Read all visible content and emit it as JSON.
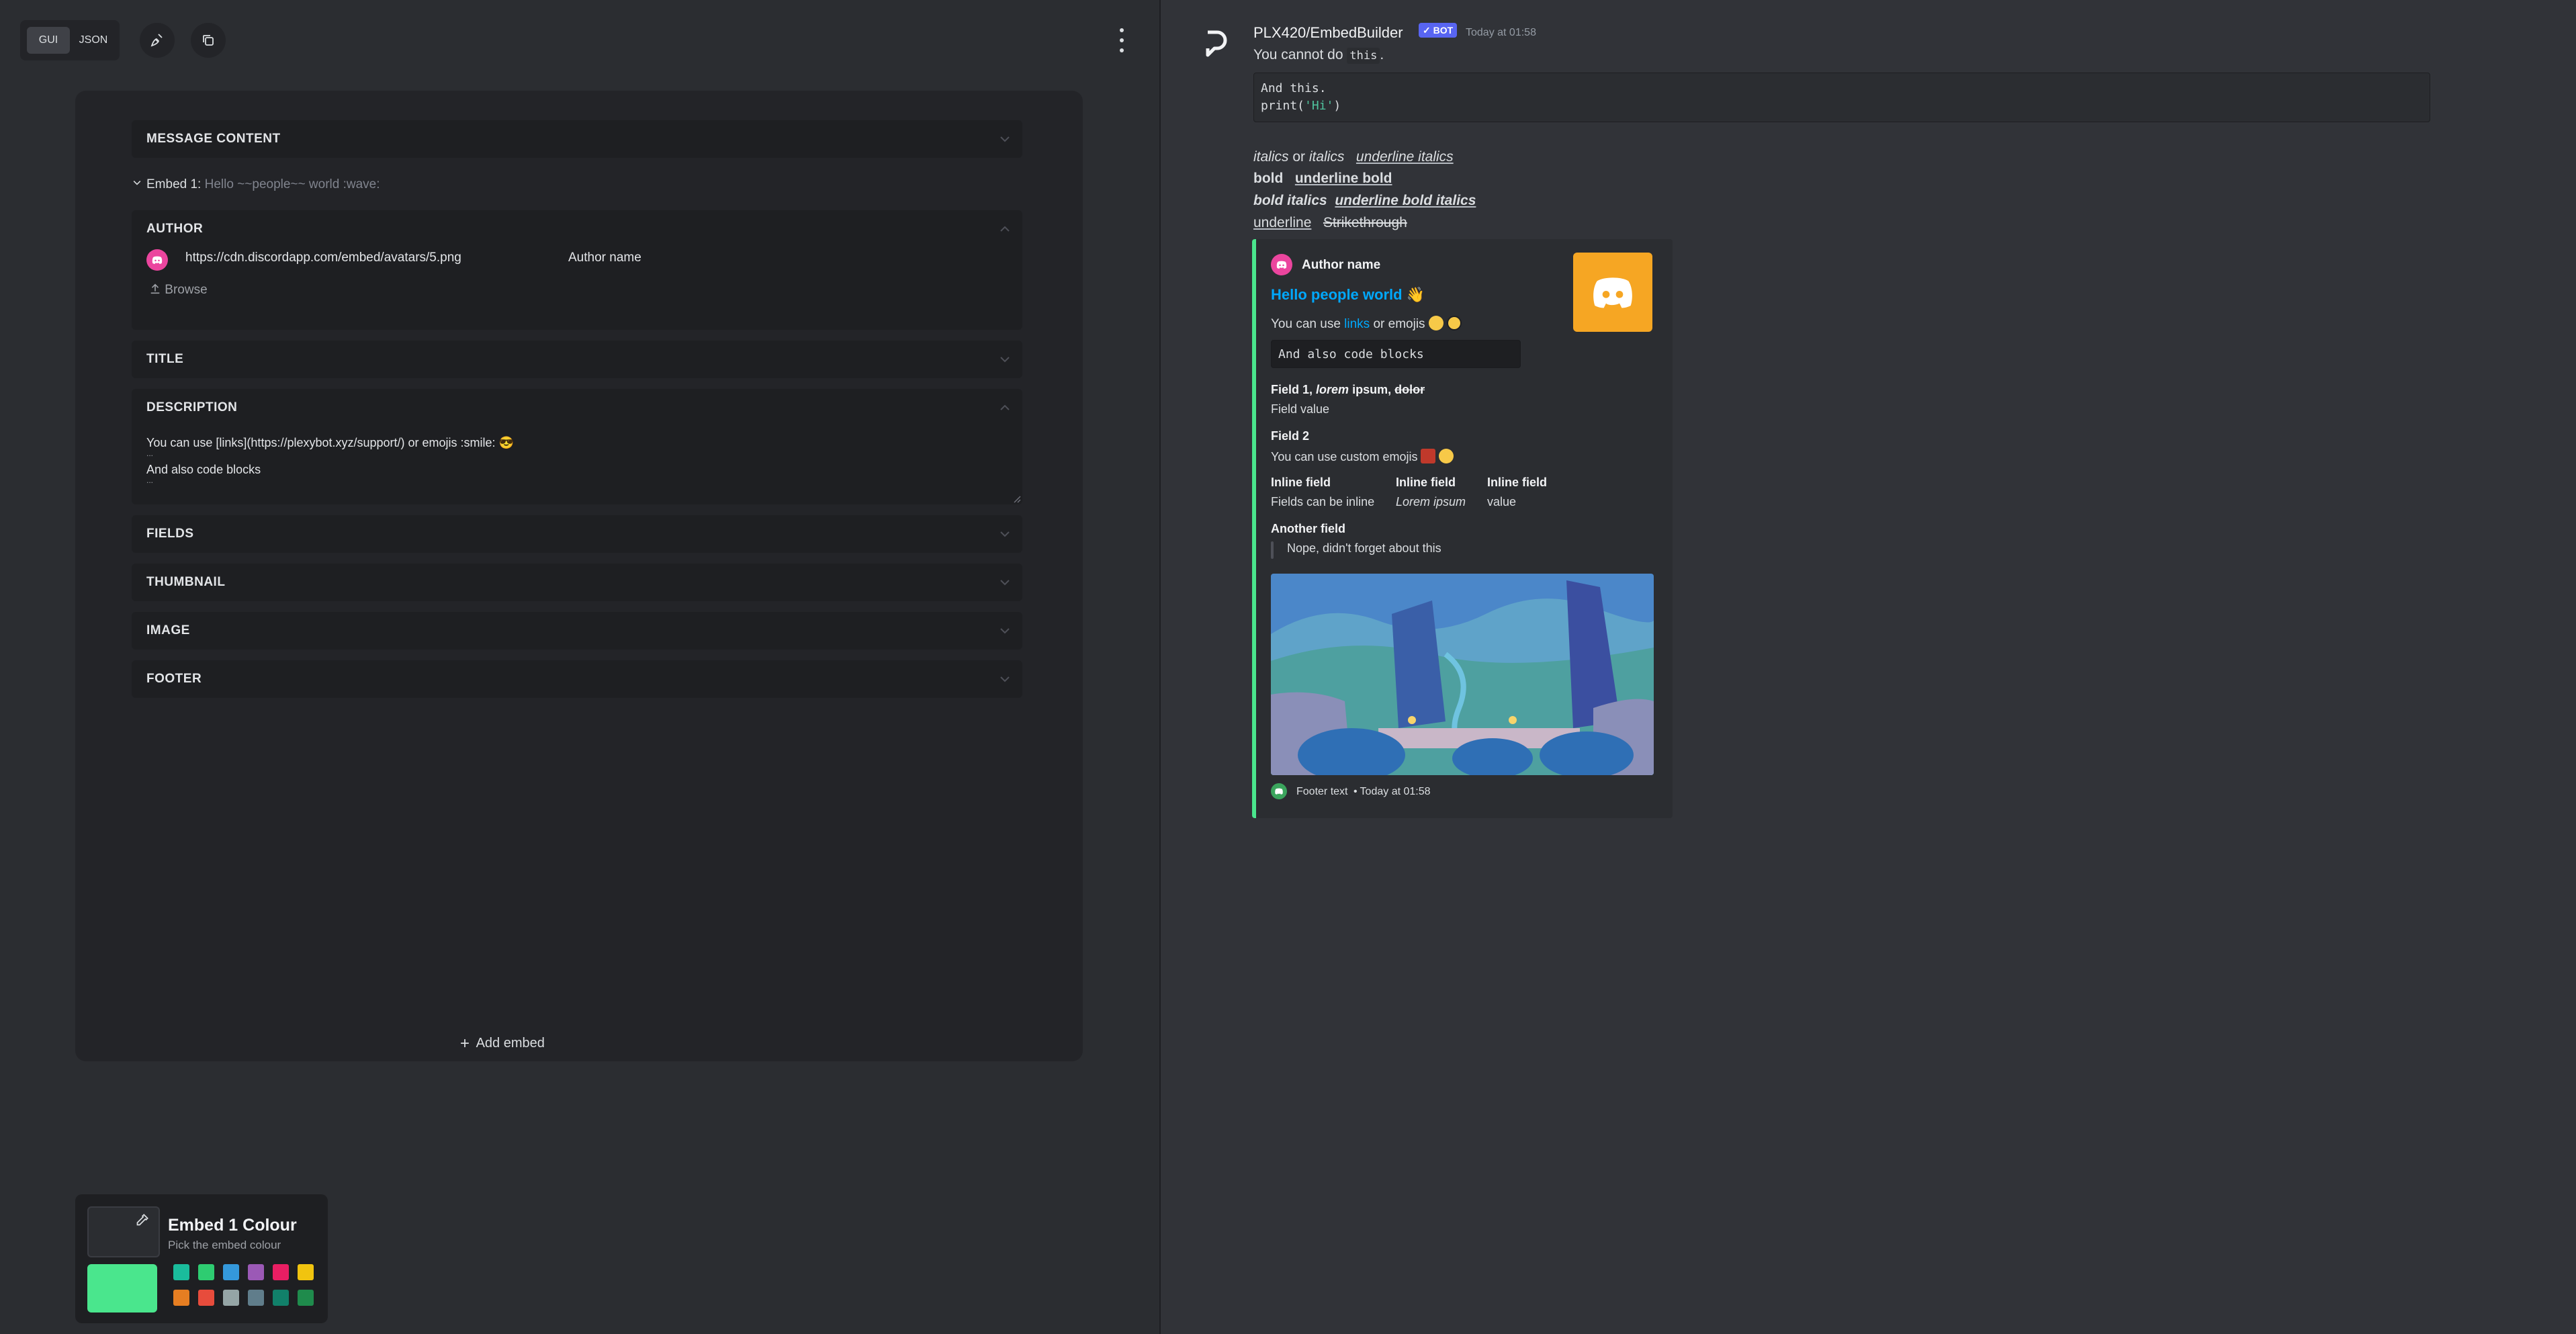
{
  "toolbar": {
    "gui_label": "GUI",
    "json_label": "JSON"
  },
  "editor": {
    "message_content": "MESSAGE CONTENT",
    "embed_label": "Embed 1:",
    "embed_preview": "Hello ~~people~~ world :wave:",
    "author_section": "AUTHOR",
    "author_icon_url": "https://cdn.discordapp.com/embed/avatars/5.png",
    "author_name": "Author name",
    "browse_label": "Browse",
    "title_section": "TITLE",
    "description_section": "DESCRIPTION",
    "description_line1": "You can use [links](https://plexybot.xyz/support/) or emojis :smile: 😎",
    "description_line2": "And also code blocks",
    "description_ellipsis": "...",
    "fields_section": "FIELDS",
    "thumbnail_section": "THUMBNAIL",
    "image_section": "IMAGE",
    "footer_section": "FOOTER",
    "add_embed": "Add embed"
  },
  "color_picker": {
    "title": "Embed 1 Colour",
    "subtitle": "Pick the embed colour",
    "selected_color": "#4ae68d",
    "swatches": [
      "#1abc9c",
      "#2ecc71",
      "#3498db",
      "#9b59b6",
      "#e91e63",
      "#f1c40f",
      "#e67e22",
      "#e74c3c",
      "#95a5a6",
      "#607d8b",
      "#11806a",
      "#1f8b4c"
    ]
  },
  "preview": {
    "bot_name": "PLX420/EmbedBuilder",
    "bot_badge": "✓ BOT",
    "timestamp": "Today at 01:58",
    "line1_prefix": "You cannot do",
    "line1_code": "this",
    "line1_suffix": ".",
    "code_line1": "And this.",
    "code_line2_a": "print(",
    "code_line2_b": "'Hi'",
    "code_line2_c": ")",
    "italics1": "italics",
    "or_text": "or",
    "italics2": "italics",
    "underline_italics": "underline italics",
    "bold": "bold",
    "underline_bold": "underline bold",
    "bold_italics": "bold italics",
    "underline_bold_italics": "underline bold italics",
    "underline": "underline",
    "strikethrough": "Strikethrough",
    "embed": {
      "color": "#4ae68d",
      "author": "Author name",
      "title": "Hello people world 👋",
      "desc_prefix": "You can use",
      "desc_link": "links",
      "desc_suffix": "or emojis",
      "code": "And also code blocks",
      "field1_name_a": "Field 1,",
      "field1_name_b": "lorem",
      "field1_name_c": "ipsum,",
      "field1_name_d": "dolor",
      "field1_value": "Field value",
      "field2_name": "Field 2",
      "field2_value": "You can use custom emojis",
      "inline1_name": "Inline field",
      "inline1_value": "Fields can be inline",
      "inline2_name": "Inline field",
      "inline2_value": "Lorem ipsum",
      "inline3_name": "Inline field",
      "inline3_value": "value",
      "another_name": "Another field",
      "another_value": "Nope, didn't forget about this",
      "footer_text": "Footer text",
      "footer_sep": "•",
      "footer_time": "Today at 01:58"
    }
  }
}
